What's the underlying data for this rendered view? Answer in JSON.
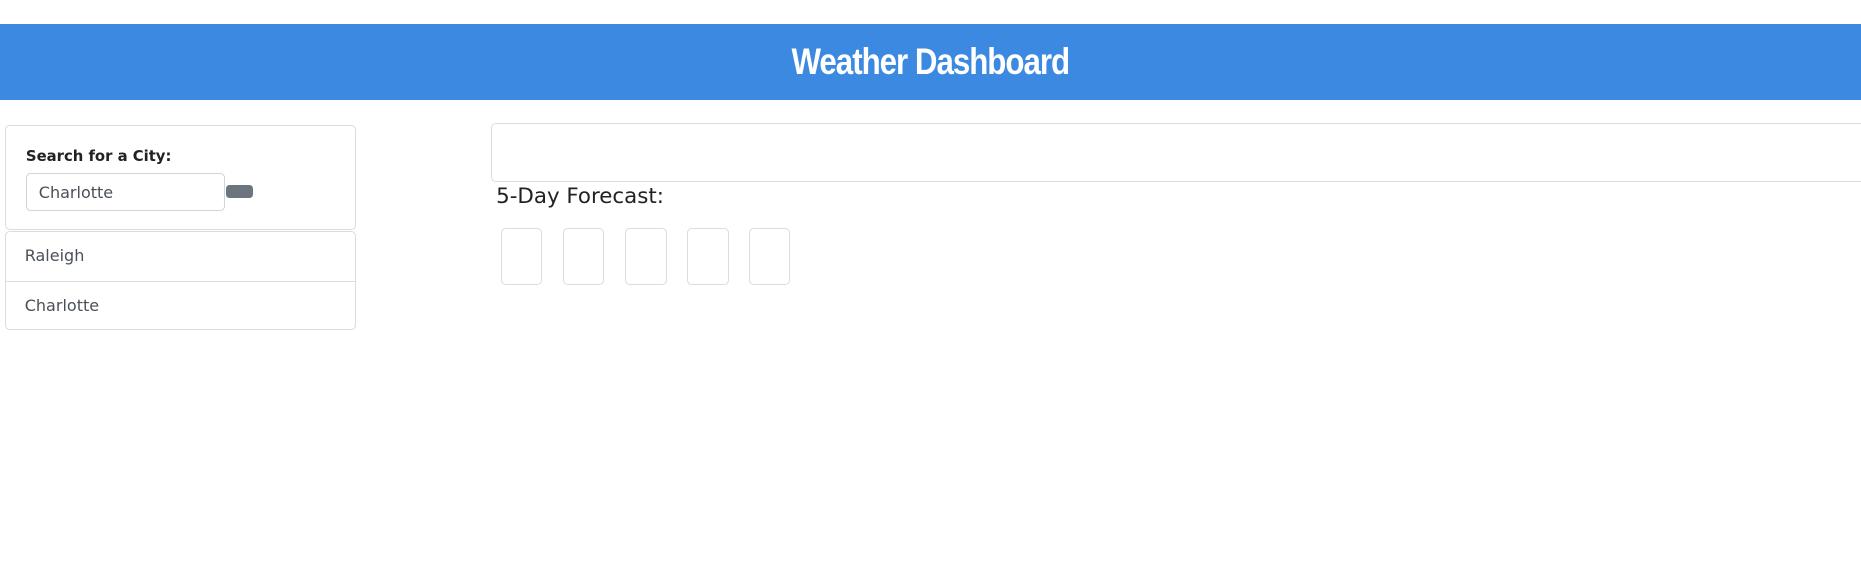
{
  "header": {
    "title": "Weather Dashboard",
    "color": "#3b89e0"
  },
  "search": {
    "label": "Search for a City:",
    "value": "Charlotte"
  },
  "history": [
    {
      "label": "Raleigh"
    },
    {
      "label": "Charlotte"
    }
  ],
  "forecast": {
    "title": "5-Day Forecast:",
    "days": 5
  }
}
